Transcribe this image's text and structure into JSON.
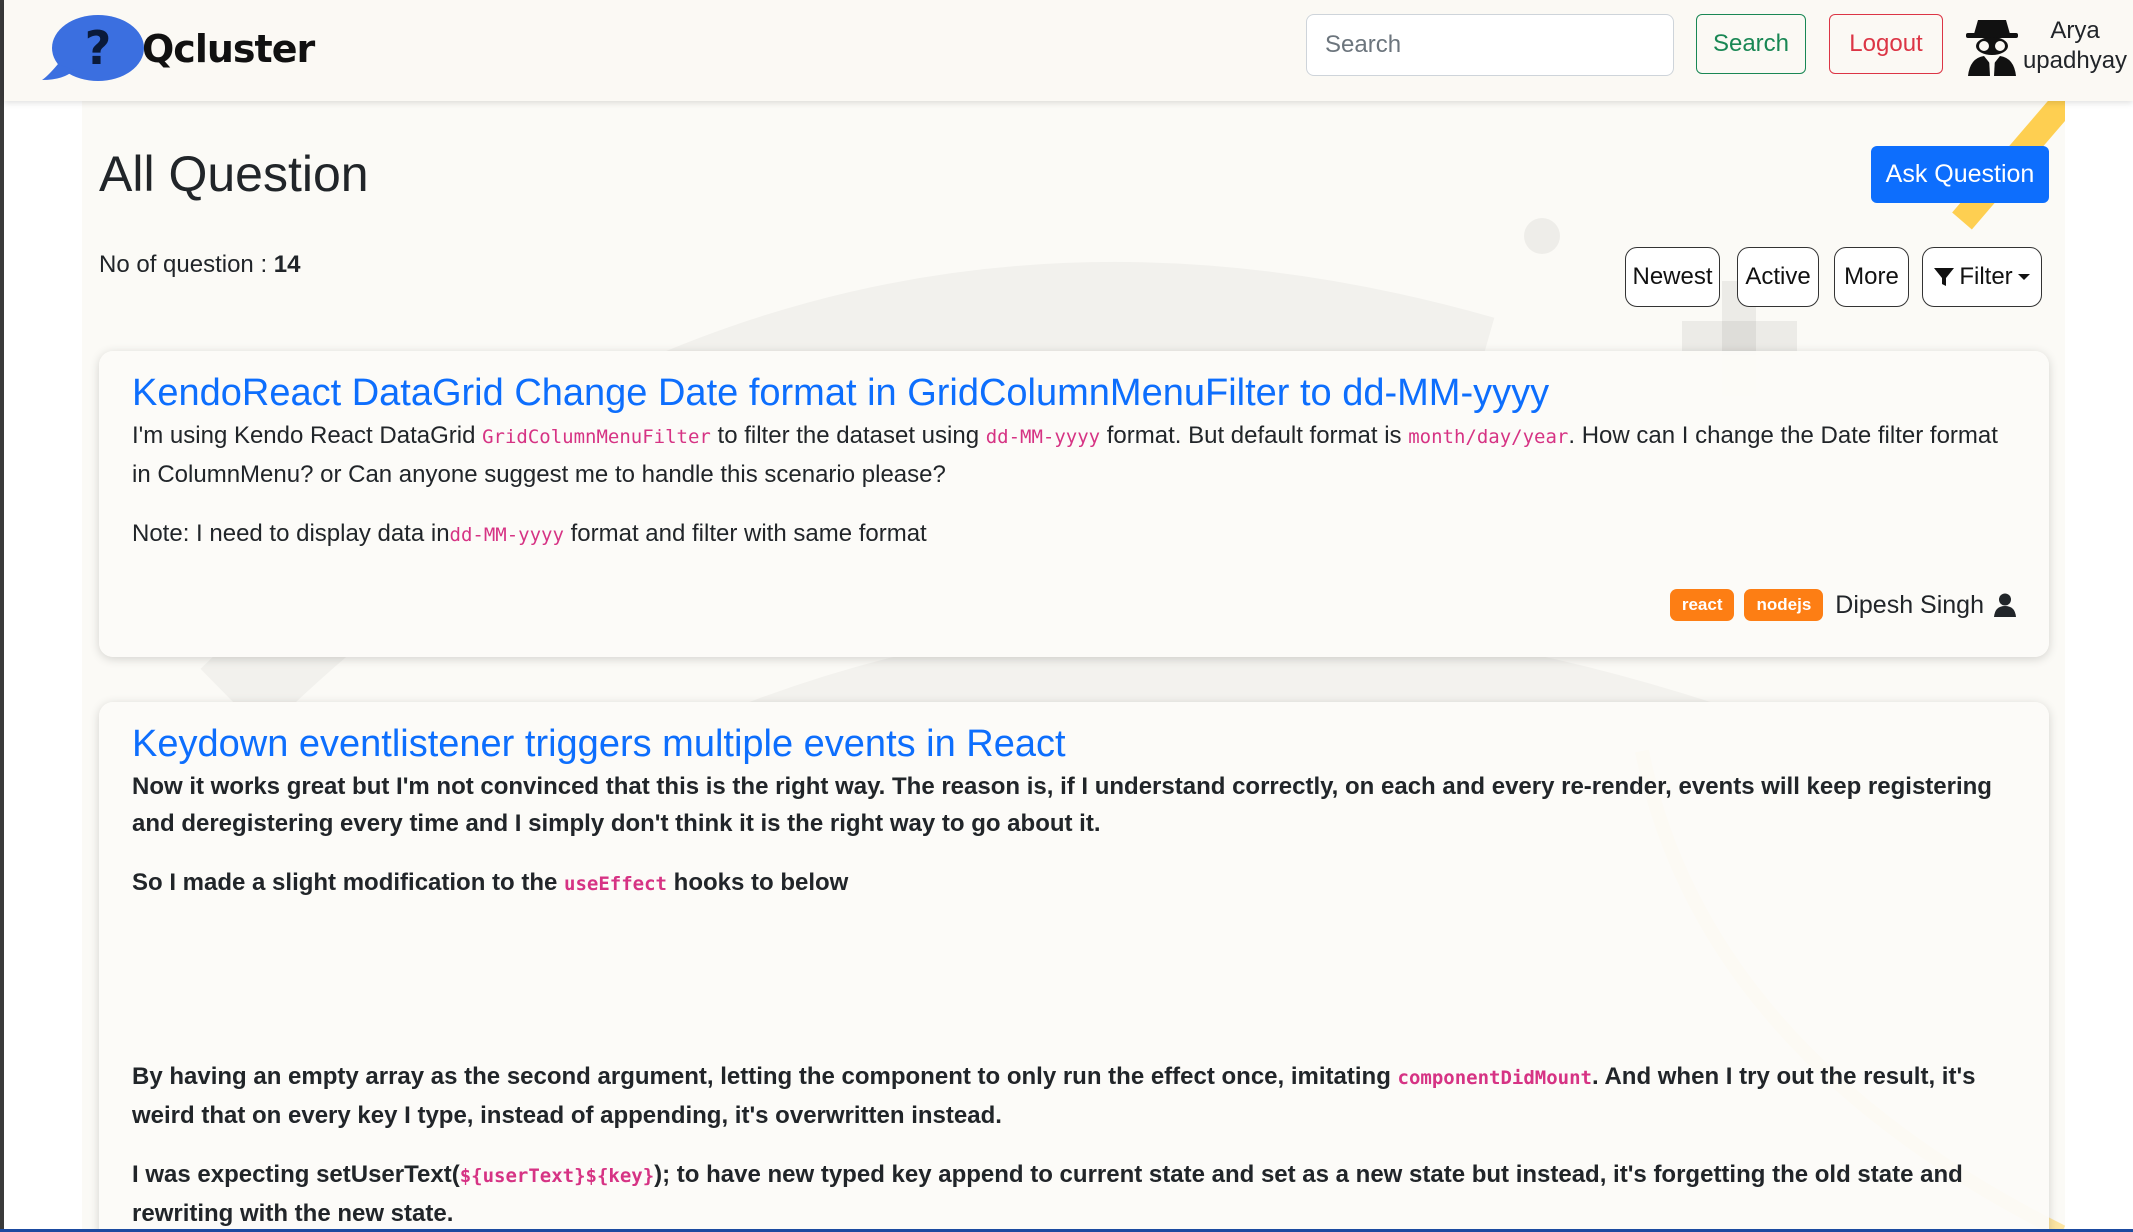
{
  "header": {
    "logo_text": "Qcluster",
    "search_placeholder": "Search",
    "search_value": "",
    "search_button": "Search",
    "logout_button": "Logout",
    "user_name": "Arya upadhyay"
  },
  "main": {
    "title": "All Question",
    "ask_button": "Ask Question",
    "count_label": "No of question : ",
    "count_value": "14",
    "sort_buttons": {
      "newest": "Newest",
      "active": "Active",
      "more": "More",
      "filter": "Filter"
    }
  },
  "questions": [
    {
      "title": "KendoReact DataGrid Change Date format in GridColumnMenuFilter to dd-MM-yyyy",
      "p1_t1": "I'm using Kendo React DataGrid ",
      "p1_c1": "GridColumnMenuFilter",
      "p1_t2": " to filter the dataset using ",
      "p1_c2": "dd-MM-yyyy",
      "p1_t3": " format. But default format is ",
      "p1_c3": "month/day/year",
      "p1_t4": ". How can I change the Date filter format in ColumnMenu? or Can anyone suggest me to handle this scenario please?",
      "p2_t1": "Note: I need to display data in",
      "p2_c1": "dd-MM-yyyy",
      "p2_t2": " format and filter with same format",
      "tags": [
        "react",
        "nodejs"
      ],
      "author": "Dipesh Singh"
    },
    {
      "title": "Keydown eventlistener triggers multiple events in React",
      "p1": "Now it works great but I'm not convinced that this is the right way. The reason is, if I understand correctly, on each and every re-render, events will keep registering and deregistering every time and I simply don't think it is the right way to go about it.",
      "p2_t1": "So I made a slight modification to the ",
      "p2_c1": "useEffect",
      "p2_t2": " hooks to below",
      "p3_t1": "By having an empty array as the second argument, letting the component to only run the effect once, imitating ",
      "p3_c1": "componentDidMount",
      "p3_t2": ". And when I try out the result, it's weird that on every key I type, instead of appending, it's overwritten instead.",
      "p4_t1": "I was expecting setUserText(",
      "p4_c1": "${userText}${key}",
      "p4_t2": "); to have new typed key append to current state and set as a new state but instead, it's forgetting the old state and rewriting with the new state."
    }
  ],
  "colors": {
    "primary": "#0d6efd",
    "success": "#198754",
    "danger": "#dc3545",
    "badge": "#fd7e14",
    "code": "#d63384",
    "logo": "#3b6fe0"
  }
}
